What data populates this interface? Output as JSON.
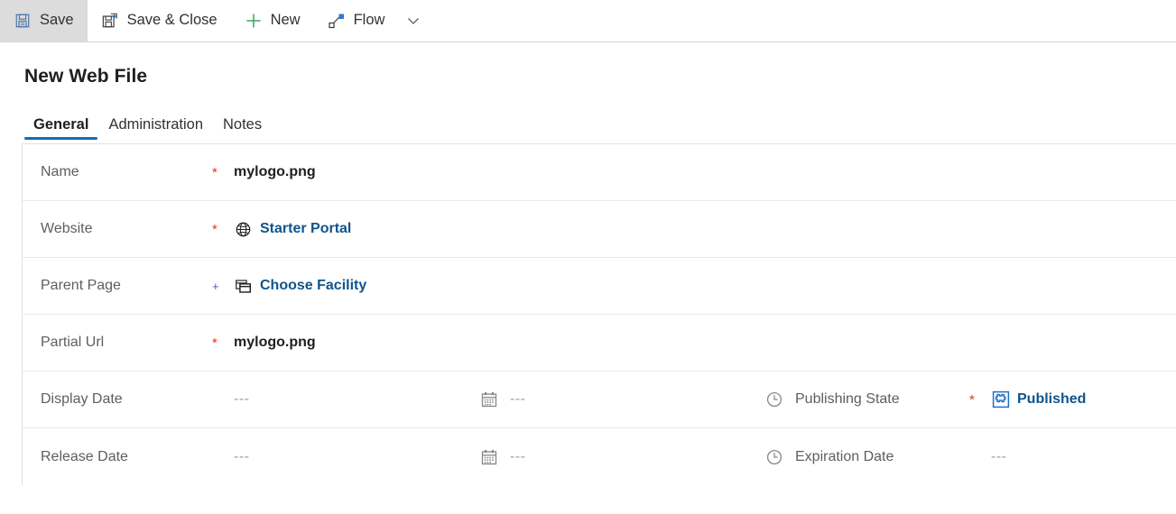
{
  "commandbar": {
    "buttons": [
      {
        "label": "Save",
        "icon": "save-icon",
        "active": true
      },
      {
        "label": "Save & Close",
        "icon": "save-close-icon",
        "active": false
      },
      {
        "label": "New",
        "icon": "plus-icon",
        "active": false
      },
      {
        "label": "Flow",
        "icon": "flow-icon",
        "active": false
      }
    ],
    "overflow_icon": "chevron-down-icon"
  },
  "header": {
    "title": "New Web File"
  },
  "tabs": [
    {
      "label": "General",
      "selected": true
    },
    {
      "label": "Administration",
      "selected": false
    },
    {
      "label": "Notes",
      "selected": false
    }
  ],
  "form": {
    "rows": [
      {
        "type": "text",
        "label": "Name",
        "marker": "*",
        "marker_kind": "required",
        "value": "mylogo.png"
      },
      {
        "type": "lookup",
        "label": "Website",
        "marker": "*",
        "marker_kind": "required",
        "icon": "globe-icon",
        "value": "Starter Portal"
      },
      {
        "type": "lookup",
        "label": "Parent Page",
        "marker": "+",
        "marker_kind": "recommended",
        "icon": "pages-icon",
        "value": "Choose Facility"
      },
      {
        "type": "text",
        "label": "Partial Url",
        "marker": "*",
        "marker_kind": "required",
        "value": "mylogo.png"
      },
      {
        "type": "datetime-split",
        "label": "Display Date",
        "marker": "",
        "marker_kind": "none",
        "date_value": "---",
        "date_icon": "calendar-icon",
        "time_value": "---",
        "time_icon": "clock-icon",
        "right_label": "Publishing State",
        "right_marker": "*",
        "right_marker_kind": "required",
        "right_type": "lookup",
        "right_icon": "entity-icon",
        "right_value": "Published"
      },
      {
        "type": "datetime-split",
        "label": "Release Date",
        "marker": "",
        "marker_kind": "none",
        "date_value": "---",
        "date_icon": "calendar-icon",
        "time_value": "---",
        "time_icon": "clock-icon",
        "right_label": "Expiration Date",
        "right_marker": "",
        "right_marker_kind": "none",
        "right_type": "text",
        "right_value": "---"
      }
    ]
  },
  "colors": {
    "accent_blue": "#0f6cbd",
    "link_blue": "#0f548c",
    "required_red": "#e8321e",
    "recommended_blue": "#4b53d6",
    "new_green": "#34a853",
    "label_gray": "#605e5c",
    "active_button_gray": "#dcdcdc"
  }
}
